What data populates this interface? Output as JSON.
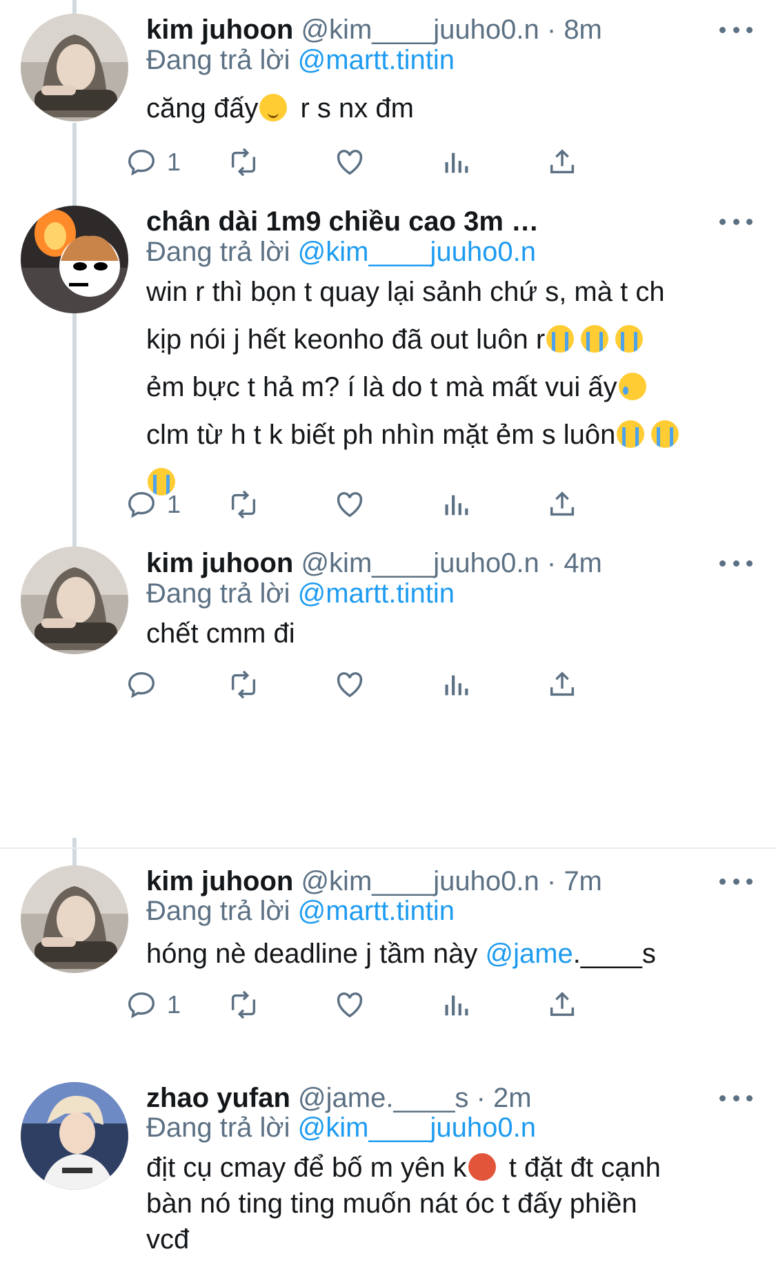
{
  "tweets": [
    {
      "name": "kim juhoon",
      "handle": "@kim____juuho0.n",
      "dot": "·",
      "time": "8m",
      "reply_prefix": "Đang trả lời",
      "reply_to": "@martt.tintin",
      "body_parts": [
        "căng đấy",
        "  r s nx đm"
      ],
      "reply_count": "1"
    },
    {
      "name": "chân dài 1m9 chiều cao 3m …",
      "reply_prefix": "Đang trả lời",
      "reply_to": "@kim____juuho0.n",
      "lines": [
        "win r thì bọn t quay lại sảnh chứ s, mà t ch",
        "kịp nói j hết keonho đã  out luôn r",
        "ẻm bực t hả m? í là do t mà mất vui ấy",
        "clm từ h t k biết ph nhìn mặt ẻm s luôn"
      ],
      "reply_count": "1"
    },
    {
      "name": "kim juhoon",
      "handle": "@kim____juuho0.n",
      "dot": "·",
      "time": "4m",
      "reply_prefix": "Đang trả lời",
      "reply_to": "@martt.tintin",
      "body": "chết cmm đi"
    },
    {
      "name": "kim juhoon",
      "handle": "@kim____juuho0.n",
      "dot": "·",
      "time": "7m",
      "reply_prefix": "Đang trả lời",
      "reply_to": "@martt.tintin",
      "body_text": "hóng nè deadline j tầm này ",
      "body_mention": "@jame",
      "body_suffix": ".____s",
      "reply_count": "1"
    },
    {
      "name": "zhao yufan",
      "handle": "@jame.____s",
      "dot": "·",
      "time": "2m",
      "reply_prefix": "Đang trả lời",
      "reply_to": "@kim____juuho0.n",
      "line1_a": "địt cụ cmay để bố m yên k",
      "line1_b": "  t đặt đt cạnh",
      "line2": "bàn nó ting ting muốn nát óc t đấy phiền",
      "line3": "vcđ"
    }
  ],
  "icons": {
    "reply": "reply-icon",
    "retweet": "retweet-icon",
    "like": "heart-icon",
    "views": "views-icon",
    "share": "share-icon",
    "more": "more-icon"
  },
  "colors": {
    "text": "#14171a",
    "secondary": "#5b7083",
    "link": "#1d9bf0",
    "thread_line": "#cfd9de"
  }
}
